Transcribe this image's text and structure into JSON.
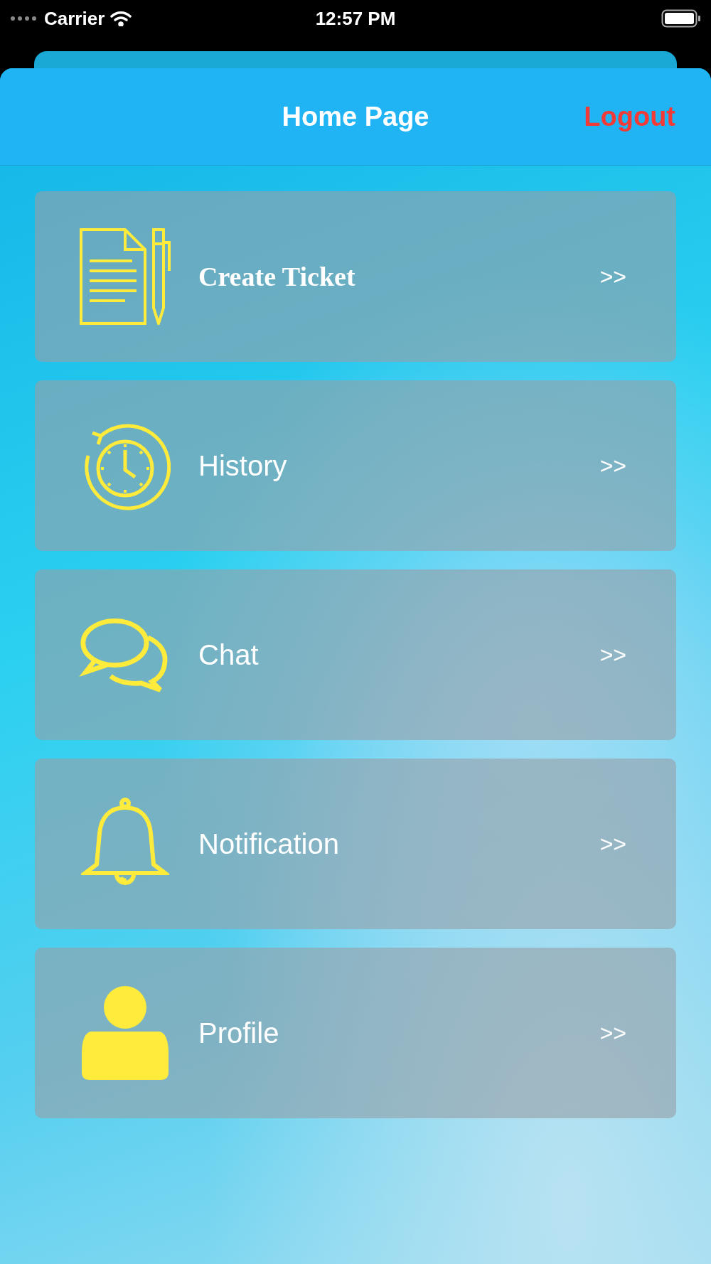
{
  "status_bar": {
    "carrier": "Carrier",
    "time": "12:57 PM"
  },
  "header": {
    "title": "Home Page",
    "action": "Logout"
  },
  "menu": [
    {
      "label": "Create Ticket",
      "kind": "document",
      "arrow": ">>"
    },
    {
      "label": "History",
      "kind": "clock",
      "arrow": ">>"
    },
    {
      "label": "Chat",
      "kind": "chat",
      "arrow": ">>"
    },
    {
      "label": "Notification",
      "kind": "bell",
      "arrow": ">>"
    },
    {
      "label": "Profile",
      "kind": "person",
      "arrow": ">>"
    }
  ]
}
